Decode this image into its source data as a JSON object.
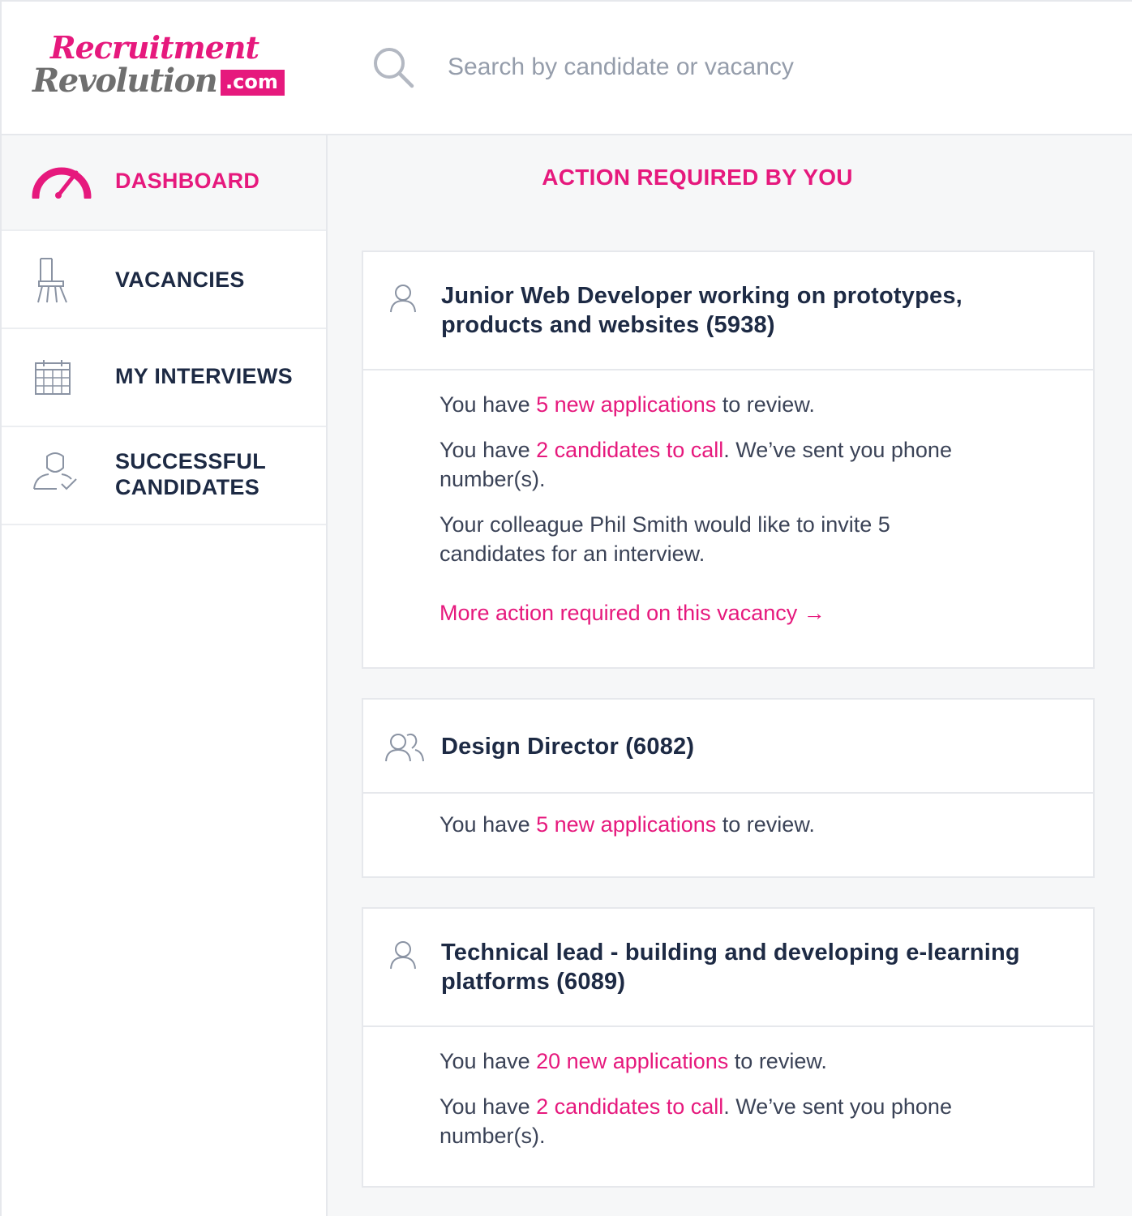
{
  "brand": {
    "line1": "Recruitment",
    "line2": "Revolution",
    "suffix": ".com",
    "accent_color": "#e6197d"
  },
  "search": {
    "icon": "search-icon",
    "placeholder": "Search by candidate or vacancy"
  },
  "sidebar": {
    "items": [
      {
        "label": "DASHBOARD",
        "icon": "speedometer-icon",
        "active": true
      },
      {
        "label": "VACANCIES",
        "icon": "chair-icon",
        "active": false
      },
      {
        "label": "MY INTERVIEWS",
        "icon": "calendar-icon",
        "active": false
      },
      {
        "label_line1": "SUCCESSFUL",
        "label_line2": "CANDIDATES",
        "icon": "user-check-icon",
        "active": false
      }
    ]
  },
  "main": {
    "title": "ACTION REQUIRED BY YOU",
    "cards": [
      {
        "icon": "user-icon",
        "title_line1": "Junior Web Developer working on prototypes,",
        "title_line2": "products and websites (5938)",
        "lines": [
          {
            "pre": "You have ",
            "link": "5 new applications",
            "post": " to review."
          },
          {
            "pre": "You have ",
            "link": "2 candidates to call",
            "post": ". We’ve sent you phone",
            "post2": "number(s)."
          },
          {
            "text1": "Your colleague Phil Smith would like to invite 5",
            "text2": "candidates for an interview."
          }
        ],
        "more_link": "More action required on this vacancy →"
      },
      {
        "icon": "users-icon",
        "title_line1": "Design Director (6082)",
        "lines": [
          {
            "pre": "You have ",
            "link": "5 new applications",
            "post": " to review."
          }
        ]
      },
      {
        "icon": "user-icon",
        "title_line1": "Technical lead - building and developing e-learning",
        "title_line2": "platforms (6089)",
        "lines": [
          {
            "pre": "You have ",
            "link": "20 new applications",
            "post": " to review."
          },
          {
            "pre": "You have ",
            "link": "2 candidates to call",
            "post": ". We’ve sent you phone",
            "post2": "number(s)."
          }
        ]
      }
    ]
  }
}
